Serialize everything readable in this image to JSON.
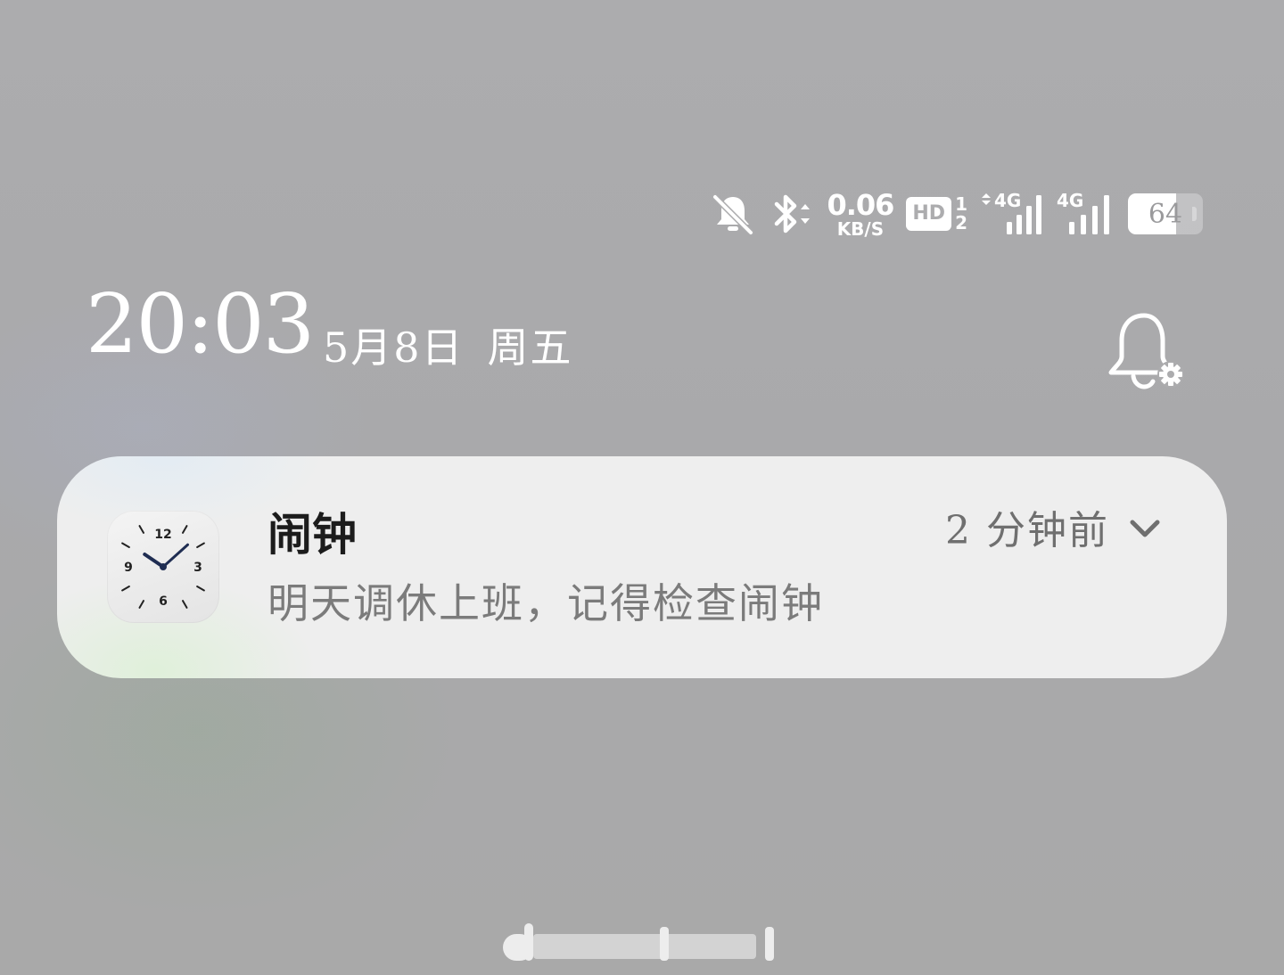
{
  "status_bar": {
    "icons": [
      "bell-muted-icon",
      "bluetooth-icon",
      "signal-icon",
      "battery-icon"
    ],
    "net_speed_value": "0.06",
    "net_speed_unit": "KB/S",
    "hd_label": "HD",
    "sim_slot_top": "1",
    "sim_slot_bottom": "2",
    "sim1_network": "4G",
    "sim2_network": "4G",
    "battery_percent": "64",
    "battery_level": 0.64
  },
  "clock": {
    "time": "20:03",
    "date": "5月8日",
    "weekday": "周五"
  },
  "notification": {
    "app_icon": "clock-app-icon",
    "app_name": "闹钟",
    "time_ago": "2 分钟前",
    "body": "明天调休上班，记得检查闹钟",
    "clock_face_numbers": [
      "12",
      "3",
      "6",
      "9"
    ],
    "clock_face_time": "10:08"
  },
  "colors": {
    "background": "#acacae",
    "card": "#eeeeee",
    "text_primary": "#1c1c1c",
    "text_secondary": "#7b7b7b",
    "clock_hands": "#1f2d52"
  }
}
